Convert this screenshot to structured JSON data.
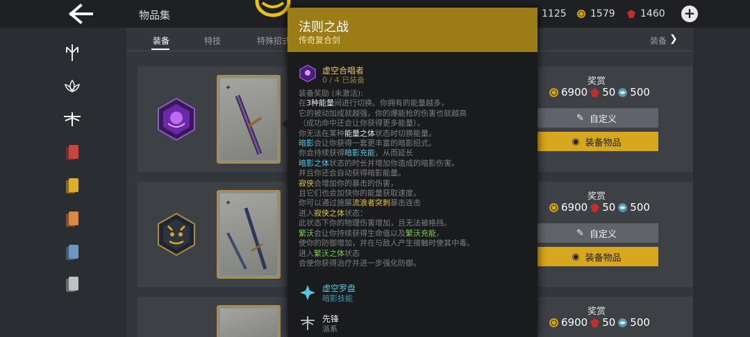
{
  "header": {
    "title": "物品集",
    "currencies": [
      {
        "icon": "gold-coin-icon",
        "value": "1125"
      },
      {
        "icon": "gold-coin-icon",
        "value": "1579"
      },
      {
        "icon": "red-gem-icon",
        "value": "1460"
      }
    ],
    "colors": {
      "gold": "#d8a720",
      "gem": "#c0302a",
      "accent": "#9c7c17"
    }
  },
  "tabs": {
    "items": [
      "装备",
      "特技",
      "特殊招式"
    ],
    "right_label": "装备"
  },
  "sidebar": {
    "icons": [
      "faction-trident-icon",
      "faction-lotus-icon",
      "faction-dragonfly-icon",
      "red-cards-icon",
      "yellow-cards-icon",
      "orange-cards-icon",
      "blue-cards-icon",
      "grey-cards-icon"
    ]
  },
  "rows": [
    {
      "emblem": "void-purple-emblem-icon",
      "reward_label": "奖赏",
      "coins": "6900",
      "gems": "50",
      "orbs": "500",
      "customize_label": "自定义",
      "equip_label": "装备物品"
    },
    {
      "emblem": "oni-mask-emblem-icon",
      "reward_label": "奖赏",
      "coins": "6900",
      "gems": "50",
      "orbs": "500",
      "customize_label": "自定义",
      "equip_label": "装备物品"
    },
    {
      "reward_label": "奖赏",
      "coins": "6900",
      "gems": "50",
      "orbs": "500"
    }
  ],
  "tooltip": {
    "title": "法则之战",
    "subtitle": "传奇复合剑",
    "set_name": "虚空合唱者",
    "set_count": "0 / 4 已装备",
    "bonus_label": "装备奖励 (未激活):",
    "skill_name": "虚空罗盘",
    "skill_type": "暗影技能",
    "faction_name": "先锋",
    "faction_type": "派系",
    "lines": [
      [
        [
          "n",
          "在"
        ],
        [
          "h",
          "3种能量"
        ],
        [
          "n",
          "间进行切换。你拥有的能量越多，"
        ]
      ],
      [
        [
          "n",
          "它的被动加成就越强，你的爆能枪的伤害也就越高"
        ]
      ],
      [
        [
          "n",
          "（成功命中还会让你获得更多能量）。"
        ]
      ],
      [
        [
          "n",
          "你无法在某种"
        ],
        [
          "h",
          "能量之体"
        ],
        [
          "n",
          "状态时切换能量。"
        ]
      ],
      [
        [
          "c",
          "暗影"
        ],
        [
          "n",
          "会让你获得一套更丰富的暗影招式。"
        ]
      ],
      [
        [
          "n",
          "你会持续获得"
        ],
        [
          "c",
          "暗影充能"
        ],
        [
          "n",
          "，从而延长"
        ]
      ],
      [
        [
          "c",
          "暗影之体"
        ],
        [
          "n",
          "状态的时长并增加你造成的暗影伤害。"
        ]
      ],
      [
        [
          "n",
          "并且你还会自动获得暗影能量。"
        ]
      ],
      [
        [
          "y",
          "寂侠"
        ],
        [
          "n",
          "会增加你的暴击的伤害，"
        ]
      ],
      [
        [
          "n",
          "且它们也会加快你的能量获取速度。"
        ]
      ],
      [
        [
          "n",
          "你可以通过施展"
        ],
        [
          "y",
          "流浪者突刺"
        ],
        [
          "n",
          "暴击连击"
        ]
      ],
      [
        [
          "n",
          "进入"
        ],
        [
          "y",
          "寂侠之体"
        ],
        [
          "n",
          "状态："
        ]
      ],
      [
        [
          "n",
          "此状态下你的物理伤害增加，且无法被格挡。"
        ]
      ],
      [
        [
          "g",
          "繁沃"
        ],
        [
          "n",
          "会让你持续获得生命值以及"
        ],
        [
          "g",
          "繁沃充能"
        ],
        [
          "n",
          "，"
        ]
      ],
      [
        [
          "n",
          "使你的防御增加，并在与敌人产生接触时使其中毒。"
        ]
      ],
      [
        [
          "n",
          "进入"
        ],
        [
          "g",
          "繁沃之体"
        ],
        [
          "n",
          "状态"
        ]
      ],
      [
        [
          "n",
          "会使你获得治疗并进一步强化防御。"
        ]
      ]
    ]
  }
}
